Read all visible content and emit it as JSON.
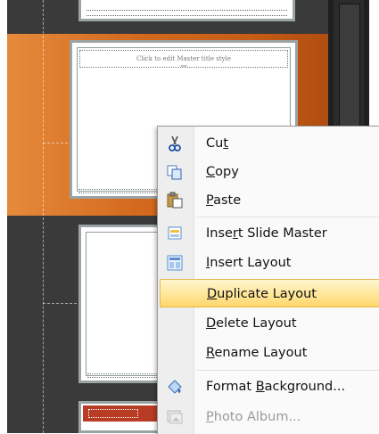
{
  "slide_panel": {
    "master_title_placeholder": "Click to edit Master title style"
  },
  "context_menu": {
    "items": [
      {
        "pre": "Cu",
        "key": "t",
        "post": "",
        "icon": "scissors-icon"
      },
      {
        "pre": "",
        "key": "C",
        "post": "opy",
        "icon": "copy-icon"
      },
      {
        "pre": "",
        "key": "P",
        "post": "aste",
        "icon": "paste-icon"
      },
      {
        "pre": "Inse",
        "key": "r",
        "post": "t Slide Master",
        "icon": "insert-slide-master-icon"
      },
      {
        "pre": "",
        "key": "I",
        "post": "nsert Layout",
        "icon": "insert-layout-icon"
      },
      {
        "pre": "",
        "key": "D",
        "post": "uplicate Layout",
        "icon": "",
        "highlighted": true
      },
      {
        "pre": "",
        "key": "D",
        "post": "elete Layout",
        "icon": ""
      },
      {
        "pre": "",
        "key": "R",
        "post": "ename Layout",
        "icon": ""
      },
      {
        "pre": "Format ",
        "key": "B",
        "post": "ackground...",
        "icon": "format-background-icon"
      },
      {
        "pre": "",
        "key": "P",
        "post": "hoto Album...",
        "icon": "photo-album-icon",
        "disabled": true
      }
    ]
  }
}
